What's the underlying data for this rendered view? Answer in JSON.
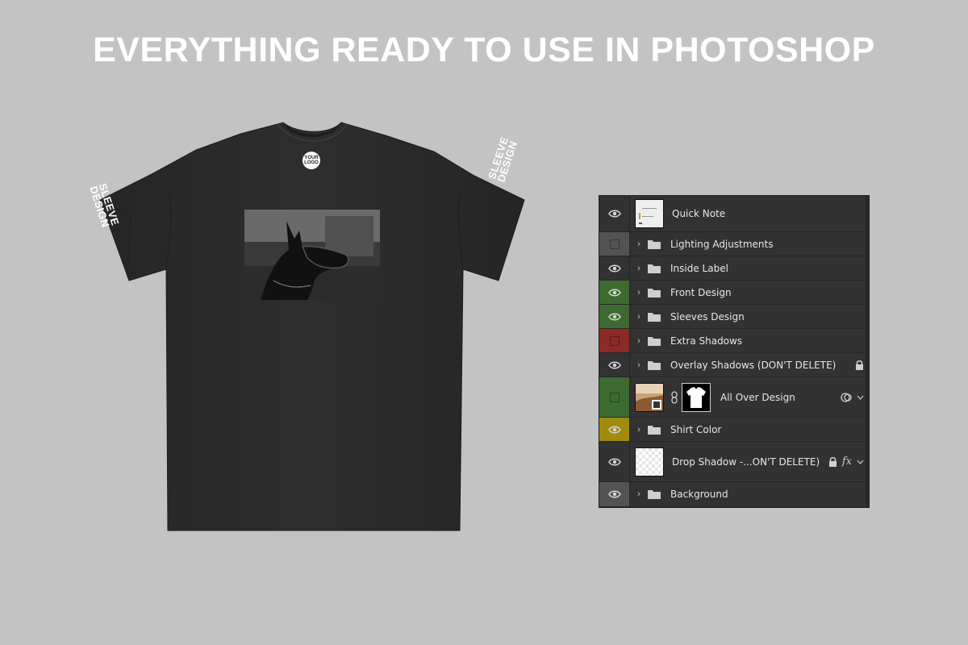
{
  "headline": "EVERYTHING READY TO USE IN PHOTOSHOP",
  "mockup": {
    "logo_line1": "YOUR",
    "logo_line2": "LOGO",
    "sleeve_line1": "SLEEVE",
    "sleeve_line2": "DESIGN",
    "shirt_color": "#2b2b2b"
  },
  "colors": {
    "background": "#c3c3c3",
    "panel_bg": "#323232",
    "green_tag": "#3d6b32",
    "red_tag": "#8b2a27",
    "yellow_tag": "#a08a10",
    "gray_tag": "#535353"
  },
  "layers": [
    {
      "name": "Quick Note",
      "type": "image",
      "visible": true,
      "tag": "none",
      "icon": "note-thumbnail"
    },
    {
      "name": "Lighting Adjustments",
      "type": "group",
      "visible": false,
      "tag": "gray"
    },
    {
      "name": "Inside Label",
      "type": "group",
      "visible": true,
      "tag": "none"
    },
    {
      "name": "Front Design",
      "type": "group",
      "visible": true,
      "tag": "green"
    },
    {
      "name": "Sleeves Design",
      "type": "group",
      "visible": true,
      "tag": "green"
    },
    {
      "name": "Extra Shadows",
      "type": "group",
      "visible": false,
      "tag": "red"
    },
    {
      "name": "Overlay Shadows (DON'T DELETE)",
      "type": "group",
      "visible": true,
      "tag": "none",
      "locked": true
    },
    {
      "name": "All Over Design",
      "type": "smart-object",
      "visible": false,
      "tag": "green"
    },
    {
      "name": "Shirt Color",
      "type": "group",
      "visible": true,
      "tag": "yellow"
    },
    {
      "name": "Drop Shadow -...ON'T DELETE)",
      "type": "image",
      "visible": true,
      "tag": "none",
      "locked": true,
      "fx": "fx"
    },
    {
      "name": "Background",
      "type": "group",
      "visible": true,
      "tag": "gray"
    }
  ]
}
